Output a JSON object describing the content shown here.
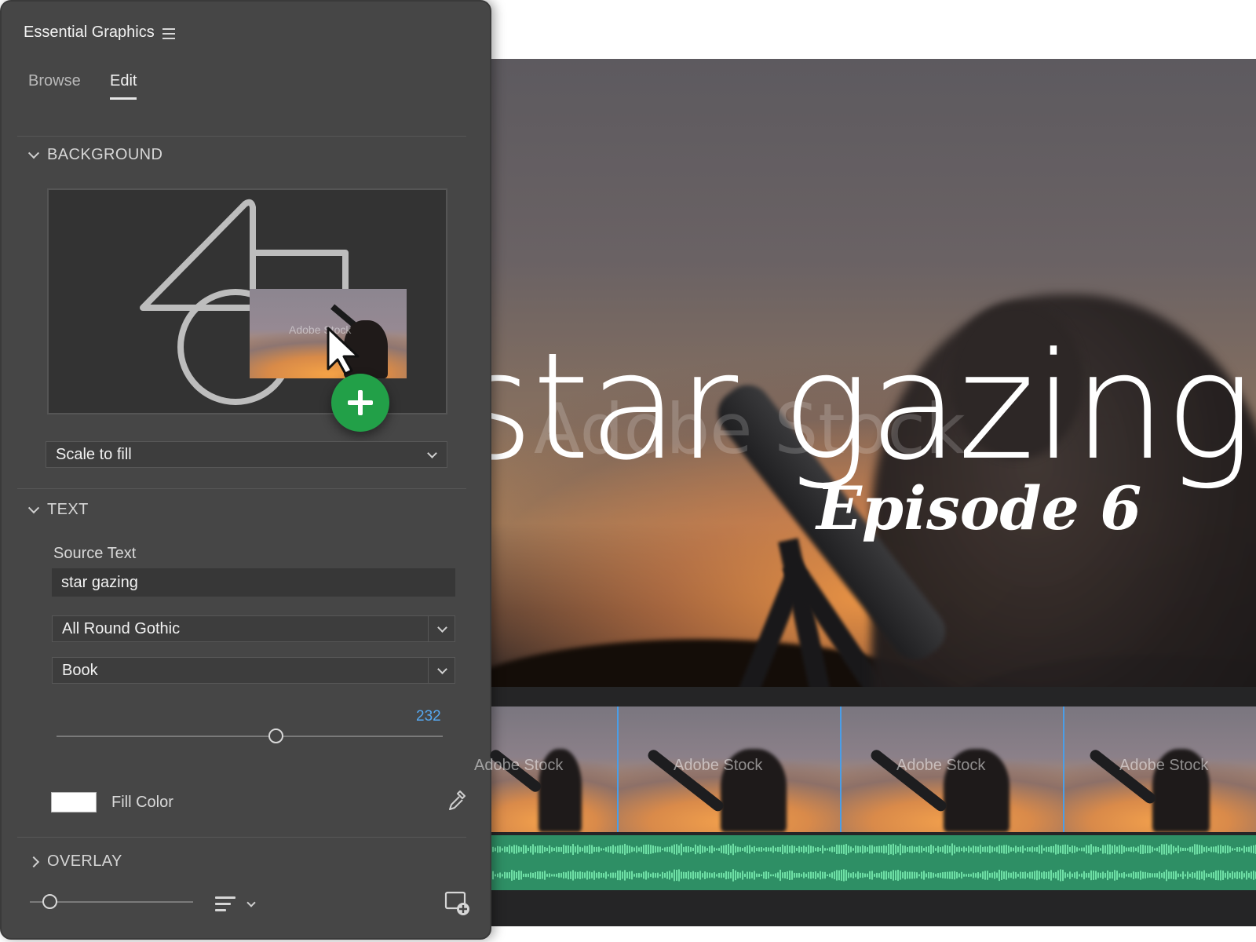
{
  "panel": {
    "title": "Essential Graphics",
    "menu_icon": "hamburger-menu-icon",
    "tabs": [
      {
        "label": "Browse",
        "active": false
      },
      {
        "label": "Edit",
        "active": true
      }
    ]
  },
  "background": {
    "header": "BACKGROUND",
    "scale_option": "Scale to fill",
    "thumb_watermark": "Adobe Stock"
  },
  "text": {
    "header": "TEXT",
    "source_label": "Source Text",
    "source_value": "star gazing",
    "font_family": "All Round Gothic",
    "font_style": "Book",
    "font_size": "232",
    "font_size_slider_fraction": 0.57,
    "fill_label": "Fill Color",
    "fill_color": "#ffffff"
  },
  "overlay": {
    "header": "OVERLAY"
  },
  "preview": {
    "title": "star gazing",
    "subtitle": "Episode 6",
    "watermark": "Adobe Stock"
  },
  "timeline": {
    "clip_watermark": "Adobe Stock",
    "clip_count": 4,
    "audio_color": "#2e8f65"
  },
  "colors": {
    "panel_bg": "#464646",
    "accent_blue": "#56a8f0",
    "add_green": "#22a048"
  }
}
